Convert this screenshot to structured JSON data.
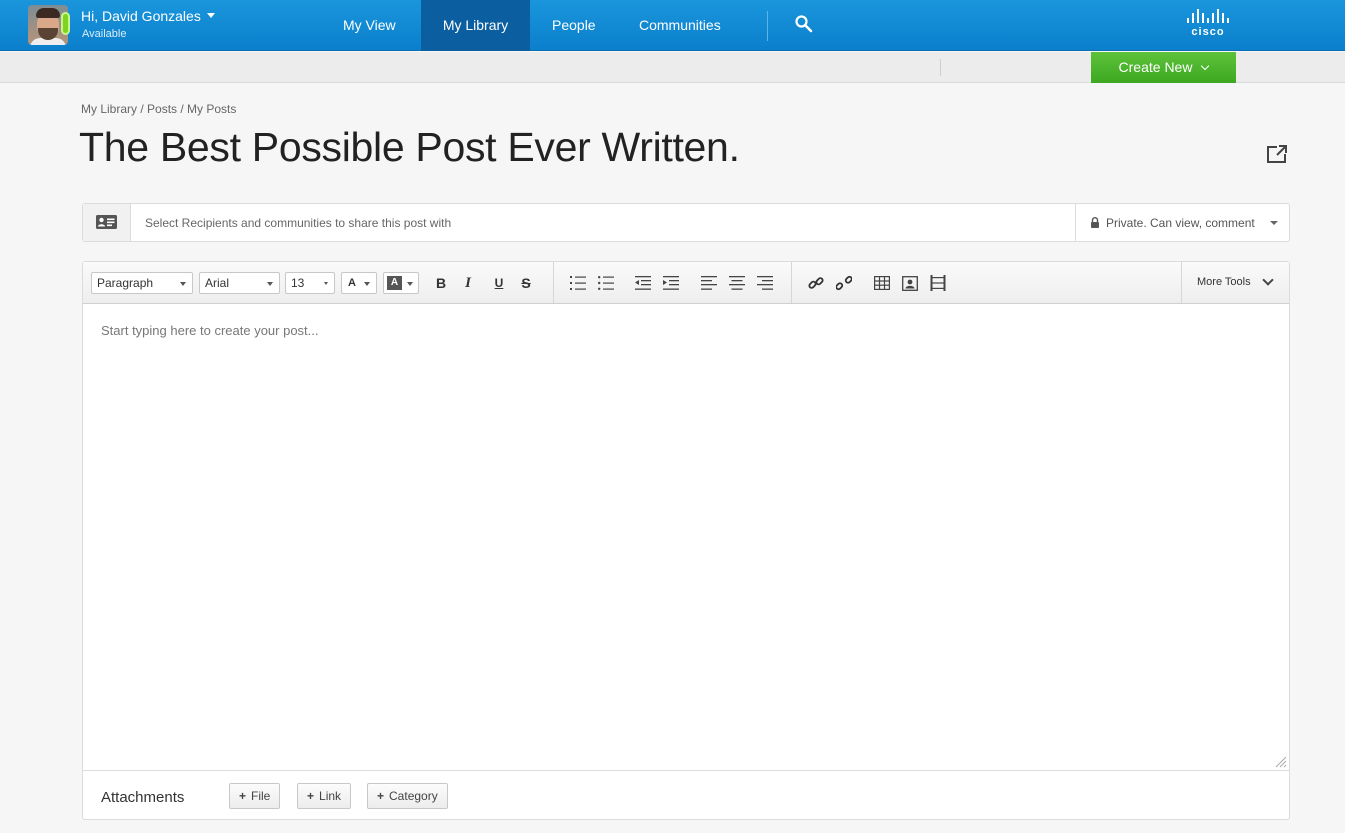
{
  "user": {
    "greeting": "Hi, David Gonzales",
    "status": "Available"
  },
  "nav": {
    "items": [
      {
        "label": "My View"
      },
      {
        "label": "My Library"
      },
      {
        "label": "People"
      },
      {
        "label": "Communities"
      }
    ],
    "active": "My Library",
    "brand": "cisco"
  },
  "subbar": {
    "create_label": "Create New"
  },
  "breadcrumb": "My Library / Posts /  My Posts",
  "title": "The Best Possible Post Ever Written.",
  "recipients": {
    "placeholder": "Select Recipients and communities to share this post with",
    "privacy": "Private. Can view, comment"
  },
  "toolbar": {
    "block_format": "Paragraph",
    "font": "Arial",
    "size": "13",
    "text_color": "A",
    "bg_color": "A",
    "bold": "B",
    "italic": "I",
    "underline": "U",
    "strike": "S",
    "more_tools": "More Tools"
  },
  "editor": {
    "placeholder": "Start typing here to create your post..."
  },
  "attachments": {
    "label": "Attachments",
    "buttons": [
      {
        "label": "File"
      },
      {
        "label": "Link"
      },
      {
        "label": "Category"
      }
    ]
  },
  "colors": {
    "nav_blue": "#0b7fcc",
    "nav_active": "#0b5fa0",
    "create_green": "#3ea821",
    "presence": "#7ed321"
  }
}
